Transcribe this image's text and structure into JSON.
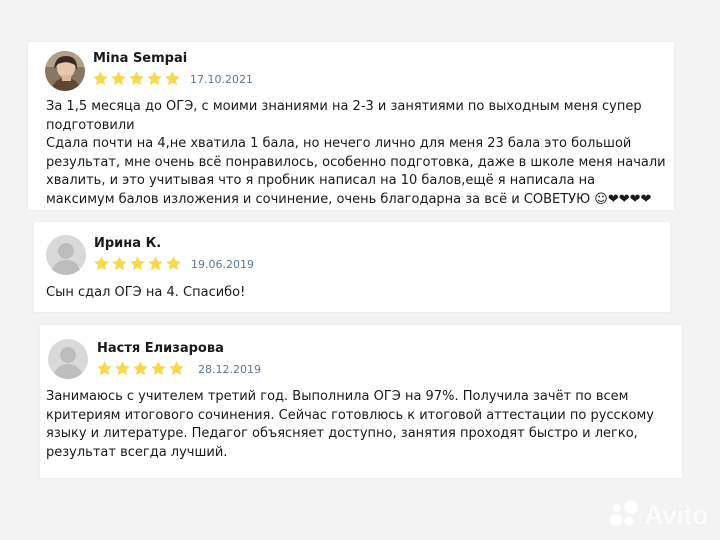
{
  "reviews": [
    {
      "author": "Mina Sempai",
      "rating": 5,
      "date": "17.10.2021",
      "avatar": "photo-avatar",
      "lines": [
        "За 1,5 месяца до ОГЭ, с моими знаниями на 2-3 и занятиями по выходным меня супер подготовили",
        "Сдала почти на 4,не хватила 1 бала, но нечего лично для меня 23 бала это большой результат, мне очень всё понравилось, особенно подготовка, даже в школе меня начали хвалить, и это учитывая что я пробник написал на 10 балов,ещё я написала на максимум балов изложения и сочинение, очень благодарна за всё и СОВЕТУЮ ☺❤❤❤❤"
      ]
    },
    {
      "author": "Ирина К.",
      "rating": 5,
      "date": "19.06.2019",
      "avatar": "default-user-avatar",
      "lines": [
        "Сын сдал ОГЭ на 4. Спасибо!"
      ]
    },
    {
      "author": "Настя Елизарова",
      "rating": 5,
      "date": "28.12.2019",
      "avatar": "default-user-avatar",
      "lines": [
        "Занимаюсь с учителем третий год. Выполнила ОГЭ на 97%. Получила зачёт по всем критериям итогового сочинения. Сейчас готовлюсь к итоговой аттестации по русскому языку и литературе. Педагог объясняет доступно, занятия проходят быстро и легко, результат всегда лучший."
      ]
    }
  ],
  "watermark": {
    "text": "Avito",
    "icon": "avito-dots-logo"
  },
  "colors": {
    "background": "#f3f3f3",
    "card": "#ffffff",
    "star": "#f9d84a",
    "date": "#5b7a93"
  }
}
